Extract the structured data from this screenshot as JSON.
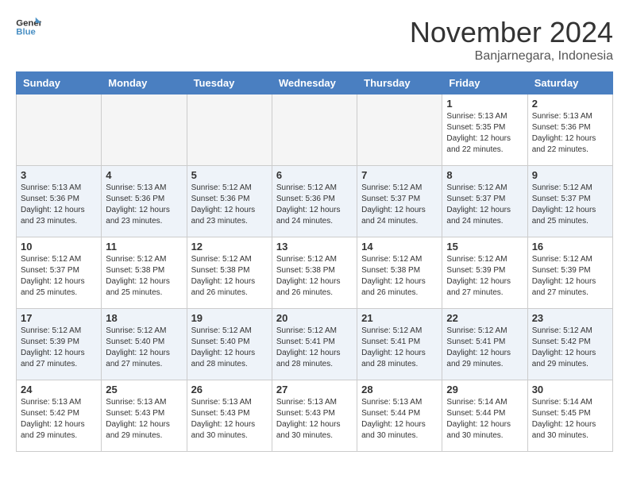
{
  "header": {
    "logo_line1": "General",
    "logo_line2": "Blue",
    "month": "November 2024",
    "location": "Banjarnegara, Indonesia"
  },
  "weekdays": [
    "Sunday",
    "Monday",
    "Tuesday",
    "Wednesday",
    "Thursday",
    "Friday",
    "Saturday"
  ],
  "weeks": [
    [
      {
        "day": "",
        "info": ""
      },
      {
        "day": "",
        "info": ""
      },
      {
        "day": "",
        "info": ""
      },
      {
        "day": "",
        "info": ""
      },
      {
        "day": "",
        "info": ""
      },
      {
        "day": "1",
        "info": "Sunrise: 5:13 AM\nSunset: 5:35 PM\nDaylight: 12 hours\nand 22 minutes."
      },
      {
        "day": "2",
        "info": "Sunrise: 5:13 AM\nSunset: 5:36 PM\nDaylight: 12 hours\nand 22 minutes."
      }
    ],
    [
      {
        "day": "3",
        "info": "Sunrise: 5:13 AM\nSunset: 5:36 PM\nDaylight: 12 hours\nand 23 minutes."
      },
      {
        "day": "4",
        "info": "Sunrise: 5:13 AM\nSunset: 5:36 PM\nDaylight: 12 hours\nand 23 minutes."
      },
      {
        "day": "5",
        "info": "Sunrise: 5:12 AM\nSunset: 5:36 PM\nDaylight: 12 hours\nand 23 minutes."
      },
      {
        "day": "6",
        "info": "Sunrise: 5:12 AM\nSunset: 5:36 PM\nDaylight: 12 hours\nand 24 minutes."
      },
      {
        "day": "7",
        "info": "Sunrise: 5:12 AM\nSunset: 5:37 PM\nDaylight: 12 hours\nand 24 minutes."
      },
      {
        "day": "8",
        "info": "Sunrise: 5:12 AM\nSunset: 5:37 PM\nDaylight: 12 hours\nand 24 minutes."
      },
      {
        "day": "9",
        "info": "Sunrise: 5:12 AM\nSunset: 5:37 PM\nDaylight: 12 hours\nand 25 minutes."
      }
    ],
    [
      {
        "day": "10",
        "info": "Sunrise: 5:12 AM\nSunset: 5:37 PM\nDaylight: 12 hours\nand 25 minutes."
      },
      {
        "day": "11",
        "info": "Sunrise: 5:12 AM\nSunset: 5:38 PM\nDaylight: 12 hours\nand 25 minutes."
      },
      {
        "day": "12",
        "info": "Sunrise: 5:12 AM\nSunset: 5:38 PM\nDaylight: 12 hours\nand 26 minutes."
      },
      {
        "day": "13",
        "info": "Sunrise: 5:12 AM\nSunset: 5:38 PM\nDaylight: 12 hours\nand 26 minutes."
      },
      {
        "day": "14",
        "info": "Sunrise: 5:12 AM\nSunset: 5:38 PM\nDaylight: 12 hours\nand 26 minutes."
      },
      {
        "day": "15",
        "info": "Sunrise: 5:12 AM\nSunset: 5:39 PM\nDaylight: 12 hours\nand 27 minutes."
      },
      {
        "day": "16",
        "info": "Sunrise: 5:12 AM\nSunset: 5:39 PM\nDaylight: 12 hours\nand 27 minutes."
      }
    ],
    [
      {
        "day": "17",
        "info": "Sunrise: 5:12 AM\nSunset: 5:39 PM\nDaylight: 12 hours\nand 27 minutes."
      },
      {
        "day": "18",
        "info": "Sunrise: 5:12 AM\nSunset: 5:40 PM\nDaylight: 12 hours\nand 27 minutes."
      },
      {
        "day": "19",
        "info": "Sunrise: 5:12 AM\nSunset: 5:40 PM\nDaylight: 12 hours\nand 28 minutes."
      },
      {
        "day": "20",
        "info": "Sunrise: 5:12 AM\nSunset: 5:41 PM\nDaylight: 12 hours\nand 28 minutes."
      },
      {
        "day": "21",
        "info": "Sunrise: 5:12 AM\nSunset: 5:41 PM\nDaylight: 12 hours\nand 28 minutes."
      },
      {
        "day": "22",
        "info": "Sunrise: 5:12 AM\nSunset: 5:41 PM\nDaylight: 12 hours\nand 29 minutes."
      },
      {
        "day": "23",
        "info": "Sunrise: 5:12 AM\nSunset: 5:42 PM\nDaylight: 12 hours\nand 29 minutes."
      }
    ],
    [
      {
        "day": "24",
        "info": "Sunrise: 5:13 AM\nSunset: 5:42 PM\nDaylight: 12 hours\nand 29 minutes."
      },
      {
        "day": "25",
        "info": "Sunrise: 5:13 AM\nSunset: 5:43 PM\nDaylight: 12 hours\nand 29 minutes."
      },
      {
        "day": "26",
        "info": "Sunrise: 5:13 AM\nSunset: 5:43 PM\nDaylight: 12 hours\nand 30 minutes."
      },
      {
        "day": "27",
        "info": "Sunrise: 5:13 AM\nSunset: 5:43 PM\nDaylight: 12 hours\nand 30 minutes."
      },
      {
        "day": "28",
        "info": "Sunrise: 5:13 AM\nSunset: 5:44 PM\nDaylight: 12 hours\nand 30 minutes."
      },
      {
        "day": "29",
        "info": "Sunrise: 5:14 AM\nSunset: 5:44 PM\nDaylight: 12 hours\nand 30 minutes."
      },
      {
        "day": "30",
        "info": "Sunrise: 5:14 AM\nSunset: 5:45 PM\nDaylight: 12 hours\nand 30 minutes."
      }
    ]
  ]
}
